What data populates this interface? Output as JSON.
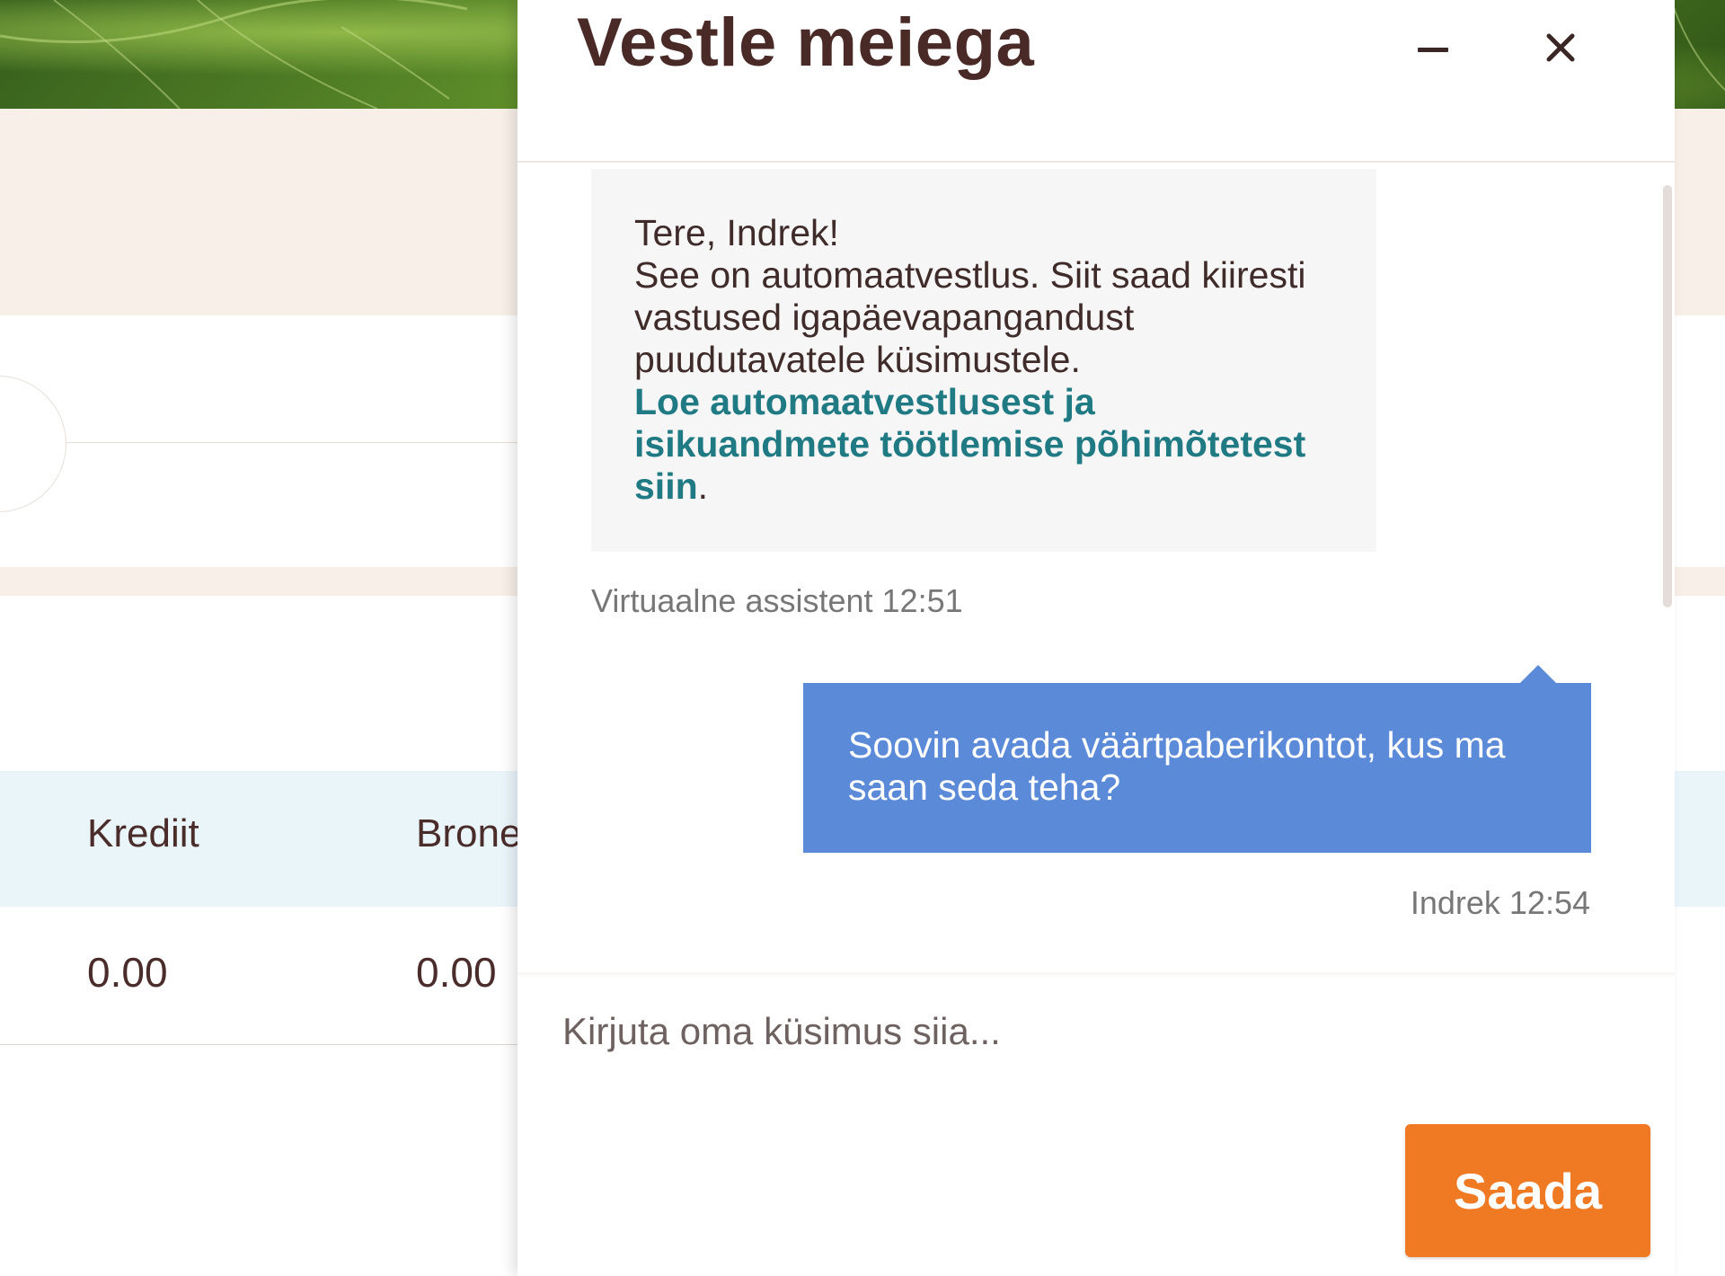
{
  "background_page": {
    "table": {
      "headers": [
        "Krediit",
        "Bronе"
      ],
      "row": [
        "0.00",
        "0.00"
      ]
    }
  },
  "chat": {
    "title": "Vestle meiega",
    "minimize_icon": "minimize-icon",
    "close_icon": "close-icon",
    "messages": [
      {
        "type": "bot",
        "lines": [
          "Tere, Indrek!",
          "See on automaatvestlus. Siit saad kiiresti vastused igapäevapangandust puudutavatele küsimustele."
        ],
        "link_text": "Loe automaatvestlusest ja isikuandmete töötlemise põhimõtetest siin",
        "link_suffix": ".",
        "meta": "Virtuaalne assistent 12:51"
      },
      {
        "type": "user",
        "text": "Soovin avada väärtpaberikontot, kus ma saan seda teha?",
        "meta": "Indrek 12:54"
      }
    ],
    "input": {
      "placeholder": "Kirjuta oma küsimus siia...",
      "value": ""
    },
    "send_label": "Saada"
  },
  "colors": {
    "title": "#4a2a26",
    "link": "#1f7a83",
    "user_bubble": "#5b8ad9",
    "send_button": "#f07a24",
    "beige": "#f8efe8",
    "table_header": "#eaf5fa"
  }
}
